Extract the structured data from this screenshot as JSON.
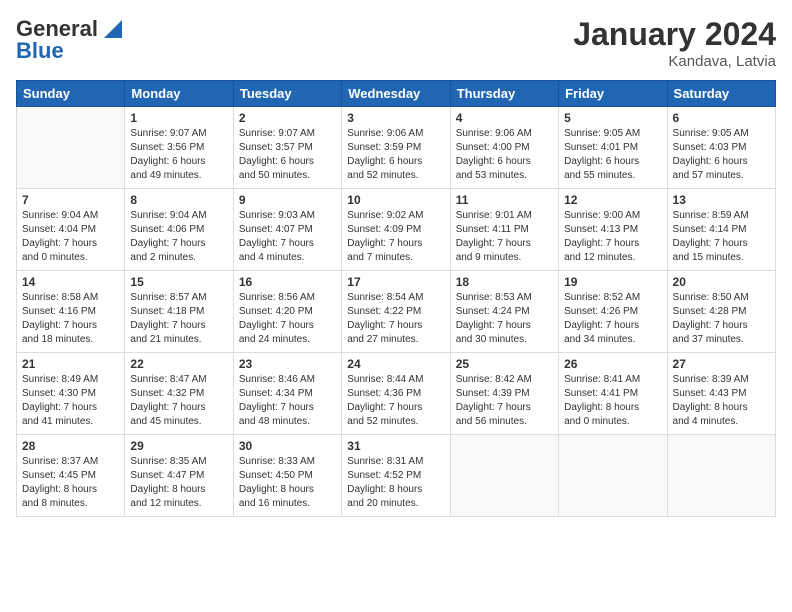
{
  "logo": {
    "general": "General",
    "blue": "Blue"
  },
  "title": "January 2024",
  "location": "Kandava, Latvia",
  "days_header": [
    "Sunday",
    "Monday",
    "Tuesday",
    "Wednesday",
    "Thursday",
    "Friday",
    "Saturday"
  ],
  "weeks": [
    [
      {
        "num": "",
        "info": ""
      },
      {
        "num": "1",
        "info": "Sunrise: 9:07 AM\nSunset: 3:56 PM\nDaylight: 6 hours\nand 49 minutes."
      },
      {
        "num": "2",
        "info": "Sunrise: 9:07 AM\nSunset: 3:57 PM\nDaylight: 6 hours\nand 50 minutes."
      },
      {
        "num": "3",
        "info": "Sunrise: 9:06 AM\nSunset: 3:59 PM\nDaylight: 6 hours\nand 52 minutes."
      },
      {
        "num": "4",
        "info": "Sunrise: 9:06 AM\nSunset: 4:00 PM\nDaylight: 6 hours\nand 53 minutes."
      },
      {
        "num": "5",
        "info": "Sunrise: 9:05 AM\nSunset: 4:01 PM\nDaylight: 6 hours\nand 55 minutes."
      },
      {
        "num": "6",
        "info": "Sunrise: 9:05 AM\nSunset: 4:03 PM\nDaylight: 6 hours\nand 57 minutes."
      }
    ],
    [
      {
        "num": "7",
        "info": "Sunrise: 9:04 AM\nSunset: 4:04 PM\nDaylight: 7 hours\nand 0 minutes."
      },
      {
        "num": "8",
        "info": "Sunrise: 9:04 AM\nSunset: 4:06 PM\nDaylight: 7 hours\nand 2 minutes."
      },
      {
        "num": "9",
        "info": "Sunrise: 9:03 AM\nSunset: 4:07 PM\nDaylight: 7 hours\nand 4 minutes."
      },
      {
        "num": "10",
        "info": "Sunrise: 9:02 AM\nSunset: 4:09 PM\nDaylight: 7 hours\nand 7 minutes."
      },
      {
        "num": "11",
        "info": "Sunrise: 9:01 AM\nSunset: 4:11 PM\nDaylight: 7 hours\nand 9 minutes."
      },
      {
        "num": "12",
        "info": "Sunrise: 9:00 AM\nSunset: 4:13 PM\nDaylight: 7 hours\nand 12 minutes."
      },
      {
        "num": "13",
        "info": "Sunrise: 8:59 AM\nSunset: 4:14 PM\nDaylight: 7 hours\nand 15 minutes."
      }
    ],
    [
      {
        "num": "14",
        "info": "Sunrise: 8:58 AM\nSunset: 4:16 PM\nDaylight: 7 hours\nand 18 minutes."
      },
      {
        "num": "15",
        "info": "Sunrise: 8:57 AM\nSunset: 4:18 PM\nDaylight: 7 hours\nand 21 minutes."
      },
      {
        "num": "16",
        "info": "Sunrise: 8:56 AM\nSunset: 4:20 PM\nDaylight: 7 hours\nand 24 minutes."
      },
      {
        "num": "17",
        "info": "Sunrise: 8:54 AM\nSunset: 4:22 PM\nDaylight: 7 hours\nand 27 minutes."
      },
      {
        "num": "18",
        "info": "Sunrise: 8:53 AM\nSunset: 4:24 PM\nDaylight: 7 hours\nand 30 minutes."
      },
      {
        "num": "19",
        "info": "Sunrise: 8:52 AM\nSunset: 4:26 PM\nDaylight: 7 hours\nand 34 minutes."
      },
      {
        "num": "20",
        "info": "Sunrise: 8:50 AM\nSunset: 4:28 PM\nDaylight: 7 hours\nand 37 minutes."
      }
    ],
    [
      {
        "num": "21",
        "info": "Sunrise: 8:49 AM\nSunset: 4:30 PM\nDaylight: 7 hours\nand 41 minutes."
      },
      {
        "num": "22",
        "info": "Sunrise: 8:47 AM\nSunset: 4:32 PM\nDaylight: 7 hours\nand 45 minutes."
      },
      {
        "num": "23",
        "info": "Sunrise: 8:46 AM\nSunset: 4:34 PM\nDaylight: 7 hours\nand 48 minutes."
      },
      {
        "num": "24",
        "info": "Sunrise: 8:44 AM\nSunset: 4:36 PM\nDaylight: 7 hours\nand 52 minutes."
      },
      {
        "num": "25",
        "info": "Sunrise: 8:42 AM\nSunset: 4:39 PM\nDaylight: 7 hours\nand 56 minutes."
      },
      {
        "num": "26",
        "info": "Sunrise: 8:41 AM\nSunset: 4:41 PM\nDaylight: 8 hours\nand 0 minutes."
      },
      {
        "num": "27",
        "info": "Sunrise: 8:39 AM\nSunset: 4:43 PM\nDaylight: 8 hours\nand 4 minutes."
      }
    ],
    [
      {
        "num": "28",
        "info": "Sunrise: 8:37 AM\nSunset: 4:45 PM\nDaylight: 8 hours\nand 8 minutes."
      },
      {
        "num": "29",
        "info": "Sunrise: 8:35 AM\nSunset: 4:47 PM\nDaylight: 8 hours\nand 12 minutes."
      },
      {
        "num": "30",
        "info": "Sunrise: 8:33 AM\nSunset: 4:50 PM\nDaylight: 8 hours\nand 16 minutes."
      },
      {
        "num": "31",
        "info": "Sunrise: 8:31 AM\nSunset: 4:52 PM\nDaylight: 8 hours\nand 20 minutes."
      },
      {
        "num": "",
        "info": ""
      },
      {
        "num": "",
        "info": ""
      },
      {
        "num": "",
        "info": ""
      }
    ]
  ]
}
